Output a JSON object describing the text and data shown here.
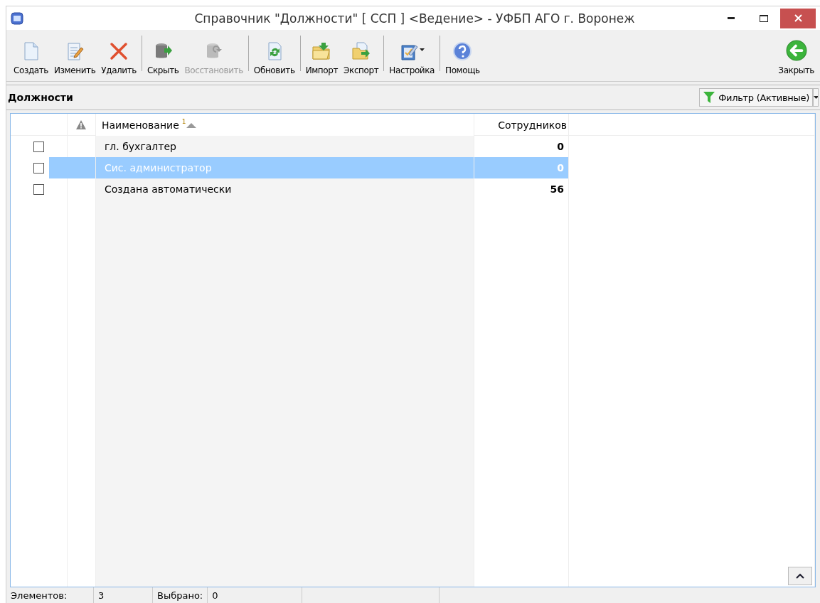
{
  "window": {
    "title": "Справочник \"Должности\" [ ССП ] <Ведение> - УФБП АГО г. Воронеж"
  },
  "toolbar": {
    "groups": [
      [
        {
          "label": "Создать",
          "kind": "new",
          "disabled": false
        },
        {
          "label": "Изменить",
          "kind": "edit",
          "disabled": false
        },
        {
          "label": "Удалить",
          "kind": "delete",
          "disabled": false
        }
      ],
      [
        {
          "label": "Скрыть",
          "kind": "hide",
          "disabled": false
        },
        {
          "label": "Восстановить",
          "kind": "restore",
          "disabled": true
        }
      ],
      [
        {
          "label": "Обновить",
          "kind": "refresh",
          "disabled": false
        }
      ],
      [
        {
          "label": "Импорт",
          "kind": "import",
          "disabled": false
        },
        {
          "label": "Экспорт",
          "kind": "export",
          "disabled": false
        }
      ],
      [
        {
          "label": "Настройка",
          "kind": "settings",
          "disabled": false
        }
      ],
      [
        {
          "label": "Помощь",
          "kind": "help",
          "disabled": false
        }
      ]
    ],
    "close": {
      "label": "Закрыть"
    }
  },
  "panel": {
    "title": "Должности",
    "filter": "Фильтр (Активные)"
  },
  "table": {
    "columns": [
      {
        "label": "Наименование",
        "sort_order": "1"
      },
      {
        "label": "Сотрудников"
      }
    ],
    "rows": [
      {
        "name": "гл. бухгалтер",
        "count": "0",
        "checked": false,
        "selected": false
      },
      {
        "name": "Сис. администратор",
        "count": "0",
        "checked": false,
        "selected": true
      },
      {
        "name": "Создана автоматически",
        "count": "56",
        "checked": false,
        "selected": false
      }
    ]
  },
  "status_bar": {
    "elements_label": "Элементов:",
    "elements": "3",
    "selected_label": "Выбрано:",
    "selected": "0"
  }
}
